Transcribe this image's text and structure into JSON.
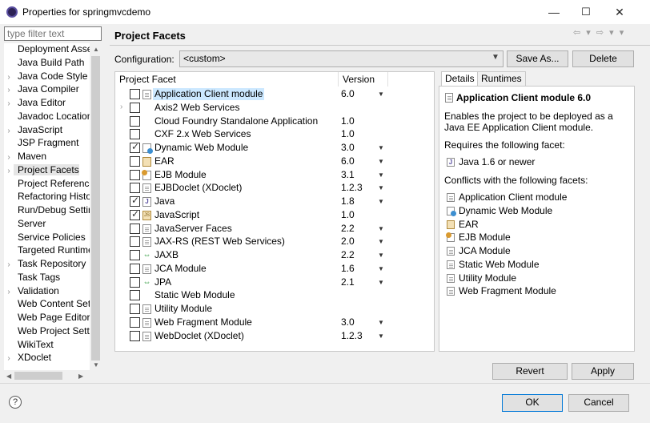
{
  "window": {
    "title": "Properties for springmvcdemo",
    "minimize": "—",
    "maximize": "☐",
    "close": "✕"
  },
  "filter": {
    "placeholder": "type filter text"
  },
  "nav": {
    "items": [
      {
        "label": "Deployment Assembly",
        "expandable": false,
        "selected": false
      },
      {
        "label": "Java Build Path",
        "expandable": false,
        "selected": false
      },
      {
        "label": "Java Code Style",
        "expandable": true,
        "selected": false
      },
      {
        "label": "Java Compiler",
        "expandable": true,
        "selected": false
      },
      {
        "label": "Java Editor",
        "expandable": true,
        "selected": false
      },
      {
        "label": "Javadoc Location",
        "expandable": false,
        "selected": false
      },
      {
        "label": "JavaScript",
        "expandable": true,
        "selected": false
      },
      {
        "label": "JSP Fragment",
        "expandable": false,
        "selected": false
      },
      {
        "label": "Maven",
        "expandable": true,
        "selected": false
      },
      {
        "label": "Project Facets",
        "expandable": true,
        "selected": true
      },
      {
        "label": "Project References",
        "expandable": false,
        "selected": false
      },
      {
        "label": "Refactoring History",
        "expandable": false,
        "selected": false
      },
      {
        "label": "Run/Debug Settings",
        "expandable": false,
        "selected": false
      },
      {
        "label": "Server",
        "expandable": false,
        "selected": false
      },
      {
        "label": "Service Policies",
        "expandable": false,
        "selected": false
      },
      {
        "label": "Targeted Runtimes",
        "expandable": false,
        "selected": false
      },
      {
        "label": "Task Repository",
        "expandable": true,
        "selected": false
      },
      {
        "label": "Task Tags",
        "expandable": false,
        "selected": false
      },
      {
        "label": "Validation",
        "expandable": true,
        "selected": false
      },
      {
        "label": "Web Content Settings",
        "expandable": false,
        "selected": false
      },
      {
        "label": "Web Page Editor",
        "expandable": false,
        "selected": false
      },
      {
        "label": "Web Project Settings",
        "expandable": false,
        "selected": false
      },
      {
        "label": "WikiText",
        "expandable": false,
        "selected": false
      },
      {
        "label": "XDoclet",
        "expandable": true,
        "selected": false
      }
    ]
  },
  "header": {
    "title": "Project Facets",
    "nav_arrows": "⇦ ▾ ⇨ ▾ ▾"
  },
  "configuration": {
    "label": "Configuration:",
    "value": "<custom>",
    "save_as": "Save As...",
    "delete": "Delete"
  },
  "facets": {
    "col_facet": "Project Facet",
    "col_version": "Version",
    "rows": [
      {
        "name": "Application Client module",
        "version": "6.0",
        "checked": false,
        "dropdown": true,
        "expandable": false,
        "icon": "doc",
        "highlight": true
      },
      {
        "name": "Axis2 Web Services",
        "version": "",
        "checked": false,
        "dropdown": false,
        "expandable": true,
        "icon": "none",
        "highlight": false
      },
      {
        "name": "Cloud Foundry Standalone Application",
        "version": "1.0",
        "checked": false,
        "dropdown": false,
        "expandable": false,
        "icon": "none",
        "highlight": false
      },
      {
        "name": "CXF 2.x Web Services",
        "version": "1.0",
        "checked": false,
        "dropdown": false,
        "expandable": false,
        "icon": "none",
        "highlight": false
      },
      {
        "name": "Dynamic Web Module",
        "version": "3.0",
        "checked": true,
        "dropdown": true,
        "expandable": false,
        "icon": "web",
        "highlight": false
      },
      {
        "name": "EAR",
        "version": "6.0",
        "checked": false,
        "dropdown": true,
        "expandable": false,
        "icon": "jar",
        "highlight": false
      },
      {
        "name": "EJB Module",
        "version": "3.1",
        "checked": false,
        "dropdown": true,
        "expandable": false,
        "icon": "ejb",
        "highlight": false
      },
      {
        "name": "EJBDoclet (XDoclet)",
        "version": "1.2.3",
        "checked": false,
        "dropdown": true,
        "expandable": false,
        "icon": "doc",
        "highlight": false
      },
      {
        "name": "Java",
        "version": "1.8",
        "checked": true,
        "dropdown": true,
        "expandable": false,
        "icon": "j",
        "highlight": false
      },
      {
        "name": "JavaScript",
        "version": "1.0",
        "checked": true,
        "dropdown": false,
        "expandable": false,
        "icon": "js",
        "highlight": false
      },
      {
        "name": "JavaServer Faces",
        "version": "2.2",
        "checked": false,
        "dropdown": true,
        "expandable": false,
        "icon": "doc",
        "highlight": false
      },
      {
        "name": "JAX-RS (REST Web Services)",
        "version": "2.0",
        "checked": false,
        "dropdown": true,
        "expandable": false,
        "icon": "doc",
        "highlight": false
      },
      {
        "name": "JAXB",
        "version": "2.2",
        "checked": false,
        "dropdown": true,
        "expandable": false,
        "icon": "arrows",
        "highlight": false
      },
      {
        "name": "JCA Module",
        "version": "1.6",
        "checked": false,
        "dropdown": true,
        "expandable": false,
        "icon": "doc",
        "highlight": false
      },
      {
        "name": "JPA",
        "version": "2.1",
        "checked": false,
        "dropdown": true,
        "expandable": false,
        "icon": "arrows",
        "highlight": false
      },
      {
        "name": "Static Web Module",
        "version": "",
        "checked": false,
        "dropdown": false,
        "expandable": false,
        "icon": "none",
        "highlight": false
      },
      {
        "name": "Utility Module",
        "version": "",
        "checked": false,
        "dropdown": false,
        "expandable": false,
        "icon": "doc",
        "highlight": false
      },
      {
        "name": "Web Fragment Module",
        "version": "3.0",
        "checked": false,
        "dropdown": true,
        "expandable": false,
        "icon": "doc",
        "highlight": false
      },
      {
        "name": "WebDoclet (XDoclet)",
        "version": "1.2.3",
        "checked": false,
        "dropdown": true,
        "expandable": false,
        "icon": "doc",
        "highlight": false
      }
    ]
  },
  "details": {
    "tab_details": "Details",
    "tab_runtimes": "Runtimes",
    "title": "Application Client module 6.0",
    "description": [
      "Enables the project to be deployed as a",
      "Java EE Application Client module."
    ],
    "requires_label": "Requires the following facet:",
    "requires": [
      {
        "label": "Java 1.6 or newer",
        "icon": "j"
      }
    ],
    "conflicts_label": "Conflicts with the following facets:",
    "conflicts": [
      {
        "label": "Application Client module",
        "icon": "doc"
      },
      {
        "label": "Dynamic Web Module",
        "icon": "web"
      },
      {
        "label": "EAR",
        "icon": "jar"
      },
      {
        "label": "EJB Module",
        "icon": "ejb"
      },
      {
        "label": "JCA Module",
        "icon": "doc"
      },
      {
        "label": "Static Web Module",
        "icon": "doc"
      },
      {
        "label": "Utility Module",
        "icon": "doc"
      },
      {
        "label": "Web Fragment Module",
        "icon": "doc"
      }
    ]
  },
  "actions": {
    "revert": "Revert",
    "apply": "Apply",
    "ok": "OK",
    "cancel": "Cancel",
    "help": "?"
  }
}
